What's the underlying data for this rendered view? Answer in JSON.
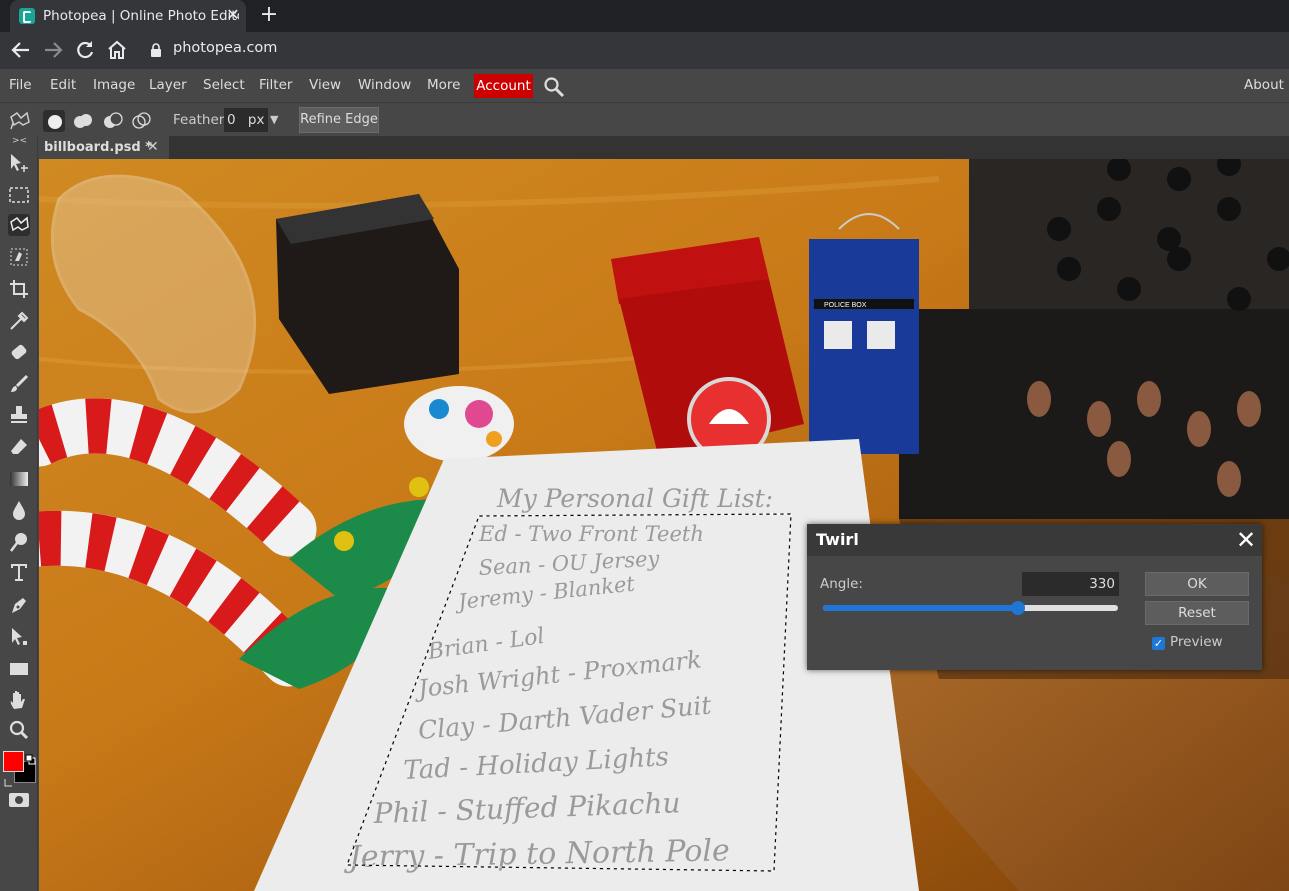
{
  "browser": {
    "tab_title": "Photopea | Online Photo Editor",
    "tab_close": "✕",
    "new_tab": "+",
    "url": "photopea.com"
  },
  "menu": {
    "items": [
      "File",
      "Edit",
      "Image",
      "Layer",
      "Select",
      "Filter",
      "View",
      "Window",
      "More"
    ],
    "account": "Account",
    "about": "About"
  },
  "options": {
    "feather_label": "Feather:",
    "feather_value": "0",
    "feather_unit": "px",
    "refine_edge": "Refine Edge"
  },
  "document": {
    "tab_label": "billboard.psd *",
    "close": "✕"
  },
  "canvas_text": {
    "title": "My Personal Gift List:",
    "lines": [
      "Ed - Two Front Teeth",
      "Sean - OU Jersey",
      "Jeremy - Blanket",
      "Brian - Lol",
      "Josh Wright - Proxmark",
      "Clay - Darth Vader Suit",
      "Tad - Holiday Lights",
      "Phil - Stuffed Pikachu",
      "Jerry - Trip to North Pole"
    ],
    "police_box": "POLICE BOX"
  },
  "dialog": {
    "title": "Twirl",
    "close": "✕",
    "angle_label": "Angle:",
    "angle_value": "330",
    "angle_fraction": 0.66,
    "ok": "OK",
    "reset": "Reset",
    "preview_label": "Preview",
    "preview_checked": true
  },
  "colors": {
    "foreground": "#ff0000",
    "background": "#000000",
    "accent": "#1e76d6",
    "account_bg": "#cc0000"
  }
}
